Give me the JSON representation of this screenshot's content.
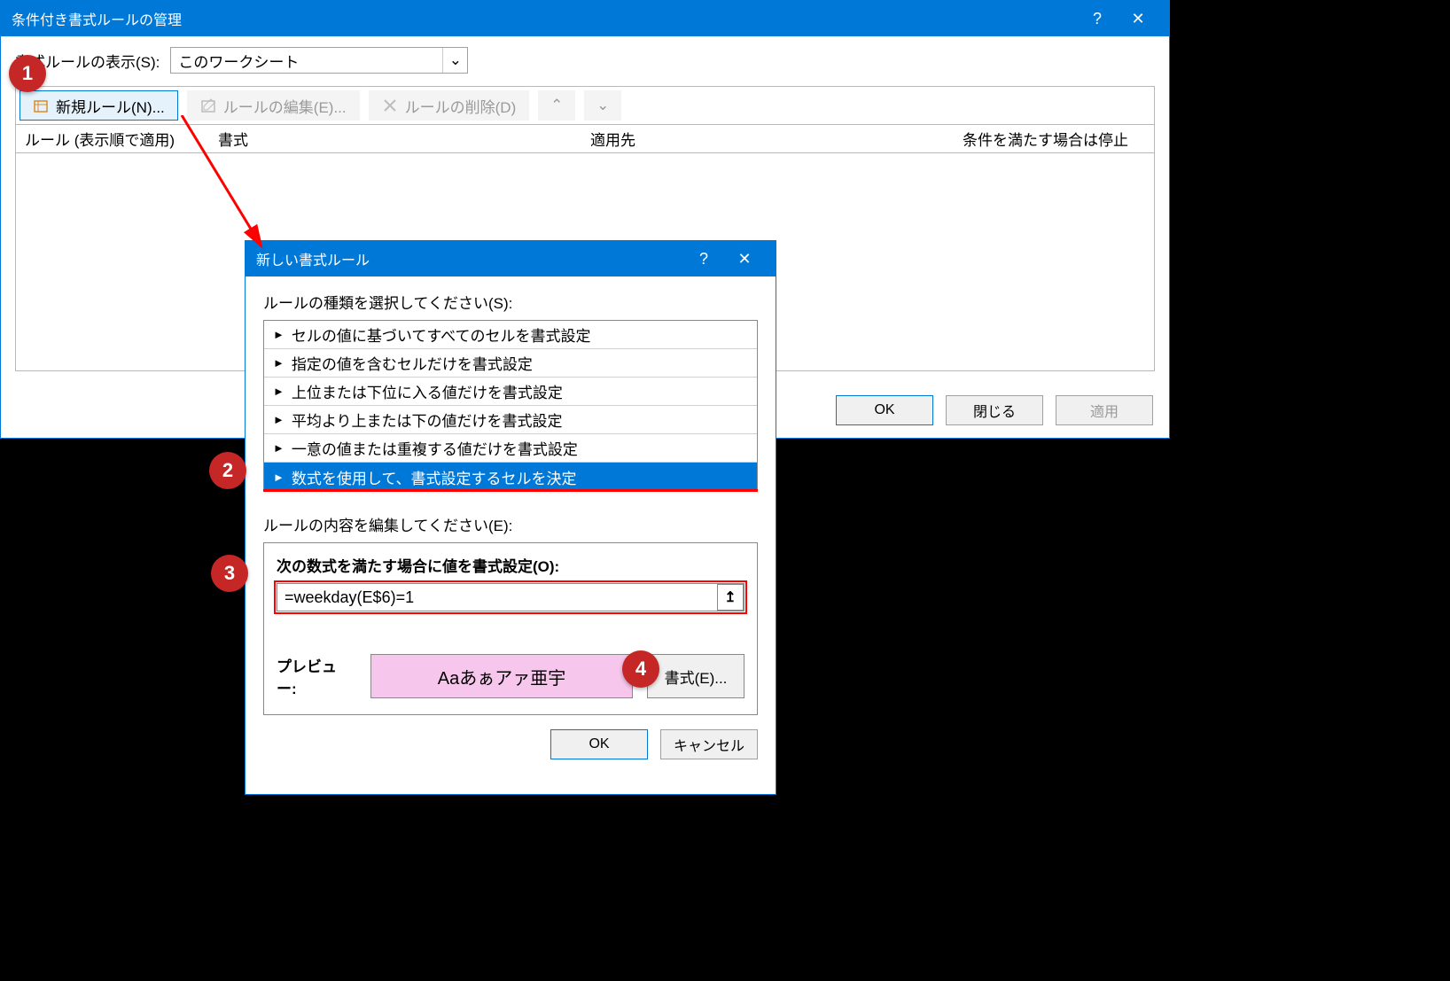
{
  "manager": {
    "title": "条件付き書式ルールの管理",
    "display_label": "書式ルールの表示(S):",
    "display_value": "このワークシート",
    "new_rule": "新規ルール(N)...",
    "edit_rule": "ルールの編集(E)...",
    "delete_rule": "ルールの削除(D)",
    "col_rule": "ルール (表示順で適用)",
    "col_format": "書式",
    "col_applies": "適用先",
    "col_stop": "条件を満たす場合は停止",
    "ok": "OK",
    "close": "閉じる",
    "apply": "適用"
  },
  "newrule": {
    "title": "新しい書式ルール",
    "type_label": "ルールの種類を選択してください(S):",
    "types": [
      "セルの値に基づいてすべてのセルを書式設定",
      "指定の値を含むセルだけを書式設定",
      "上位または下位に入る値だけを書式設定",
      "平均より上または下の値だけを書式設定",
      "一意の値または重複する値だけを書式設定",
      "数式を使用して、書式設定するセルを決定"
    ],
    "content_label": "ルールの内容を編集してください(E):",
    "formula_label": "次の数式を満たす場合に値を書式設定(O):",
    "formula_value": "=weekday(E$6)=1",
    "preview_label": "プレビュー:",
    "preview_text": "Aaあぁアァ亜宇",
    "format_btn": "書式(E)...",
    "ok": "OK",
    "cancel": "キャンセル"
  },
  "badges": {
    "b1": "1",
    "b2": "2",
    "b3": "3",
    "b4": "4"
  }
}
